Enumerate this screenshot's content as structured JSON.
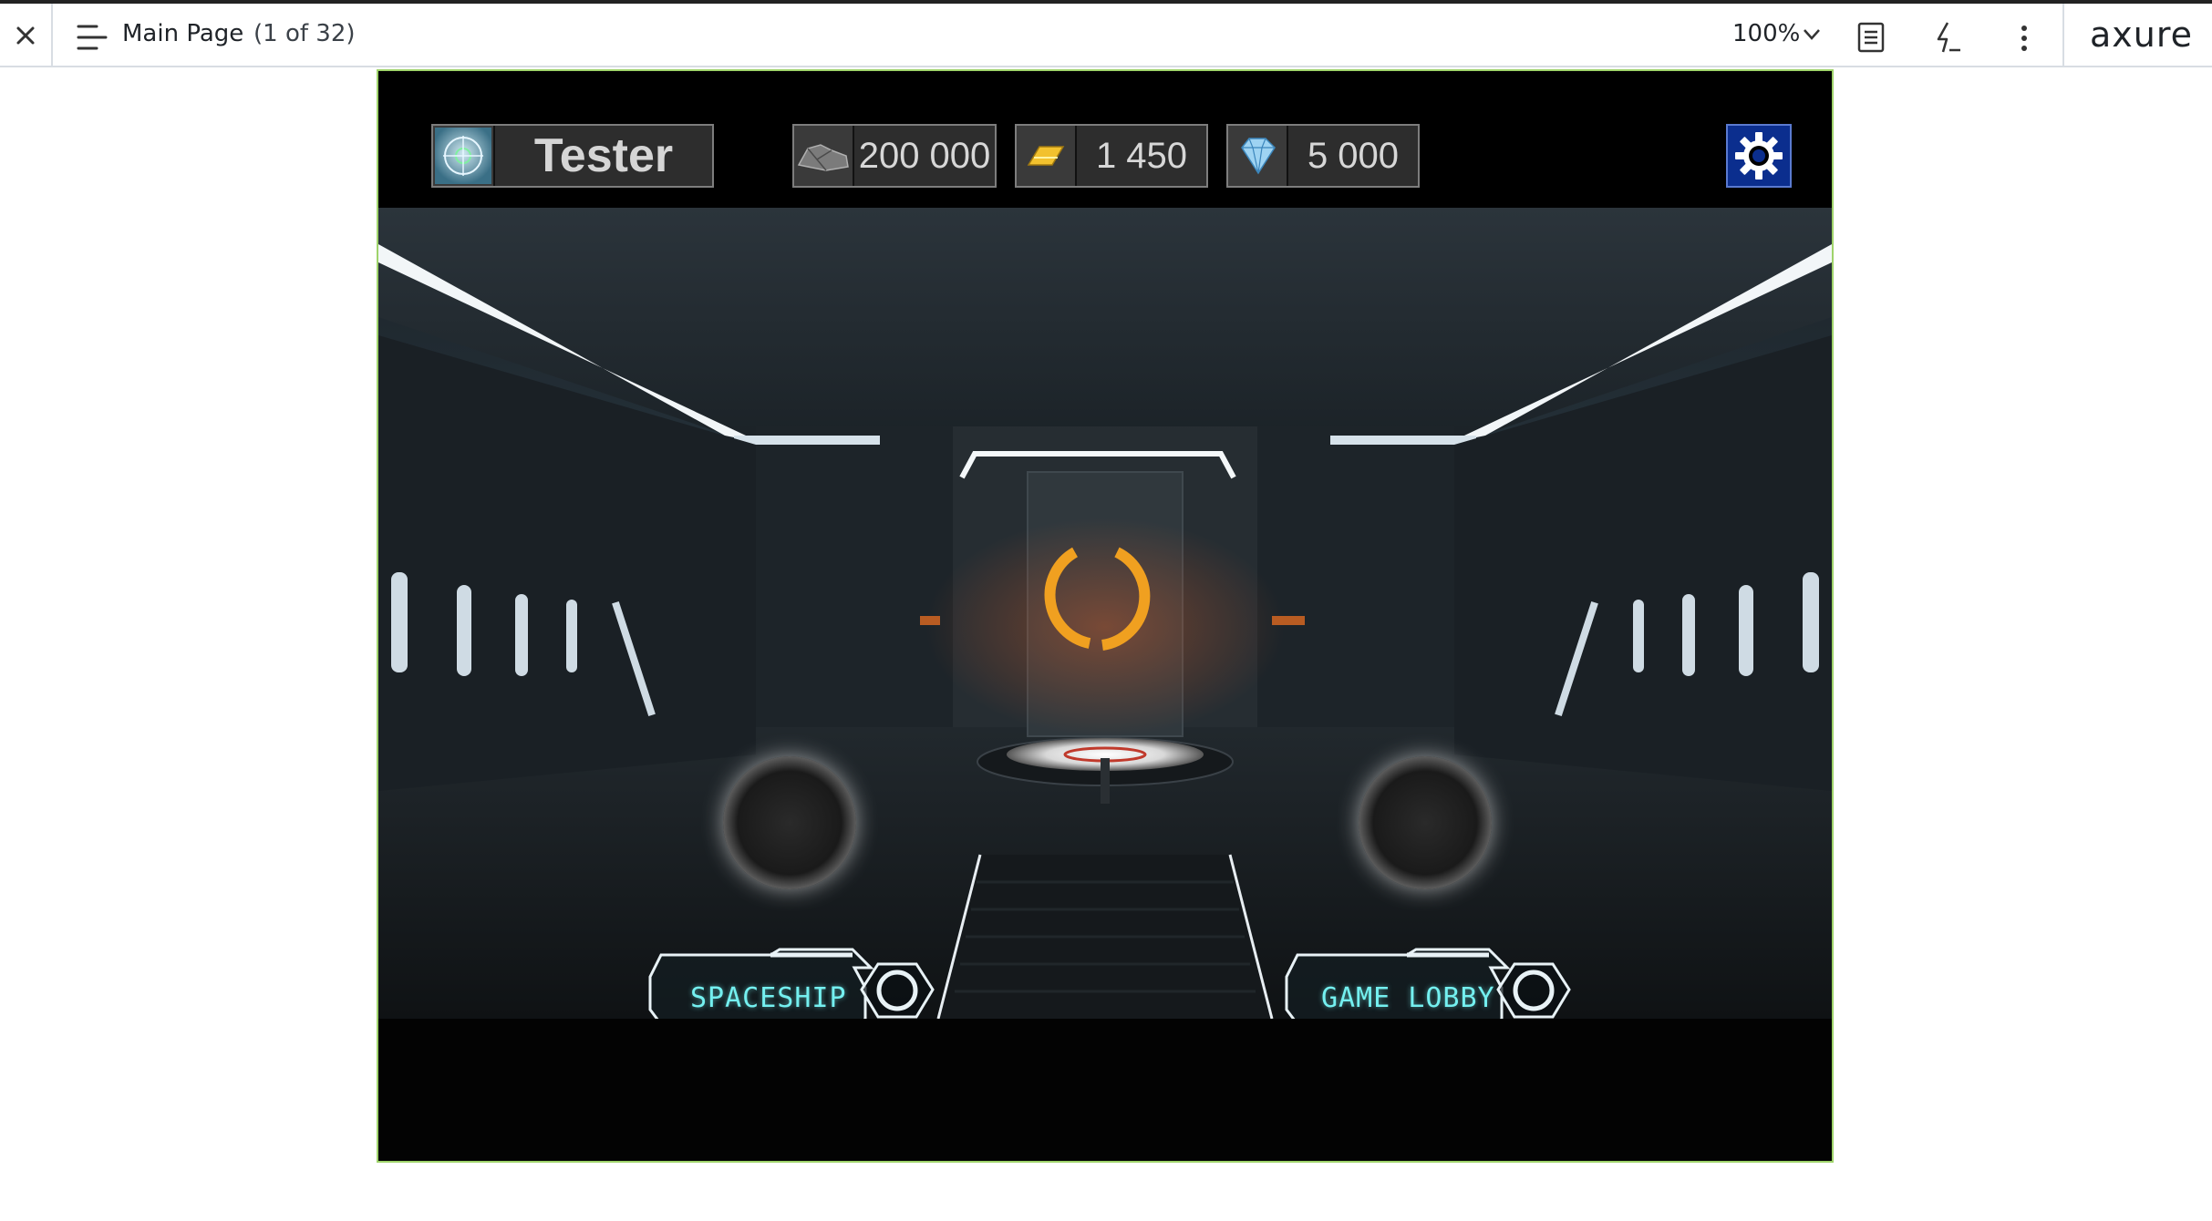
{
  "toolbar": {
    "page_title": "Main Page",
    "page_count": "(1 of 32)",
    "zoom": "100%",
    "logo": "axure"
  },
  "hud": {
    "player_name": "Tester",
    "resources": [
      {
        "icon": "ore-icon",
        "value": "200 000"
      },
      {
        "icon": "gold-bar-icon",
        "value": "1 450"
      },
      {
        "icon": "diamond-icon",
        "value": "5 000"
      }
    ],
    "settings_icon": "gear-icon"
  },
  "scene": {
    "buttons": [
      {
        "label": "SPACESHIP"
      },
      {
        "label": "GAME LOBBY"
      }
    ]
  },
  "colors": {
    "frame_border": "#9fd36b",
    "button_text": "#74f0f0",
    "settings_bg": "#0b2e8e",
    "portal_ring": "#f0a020"
  }
}
